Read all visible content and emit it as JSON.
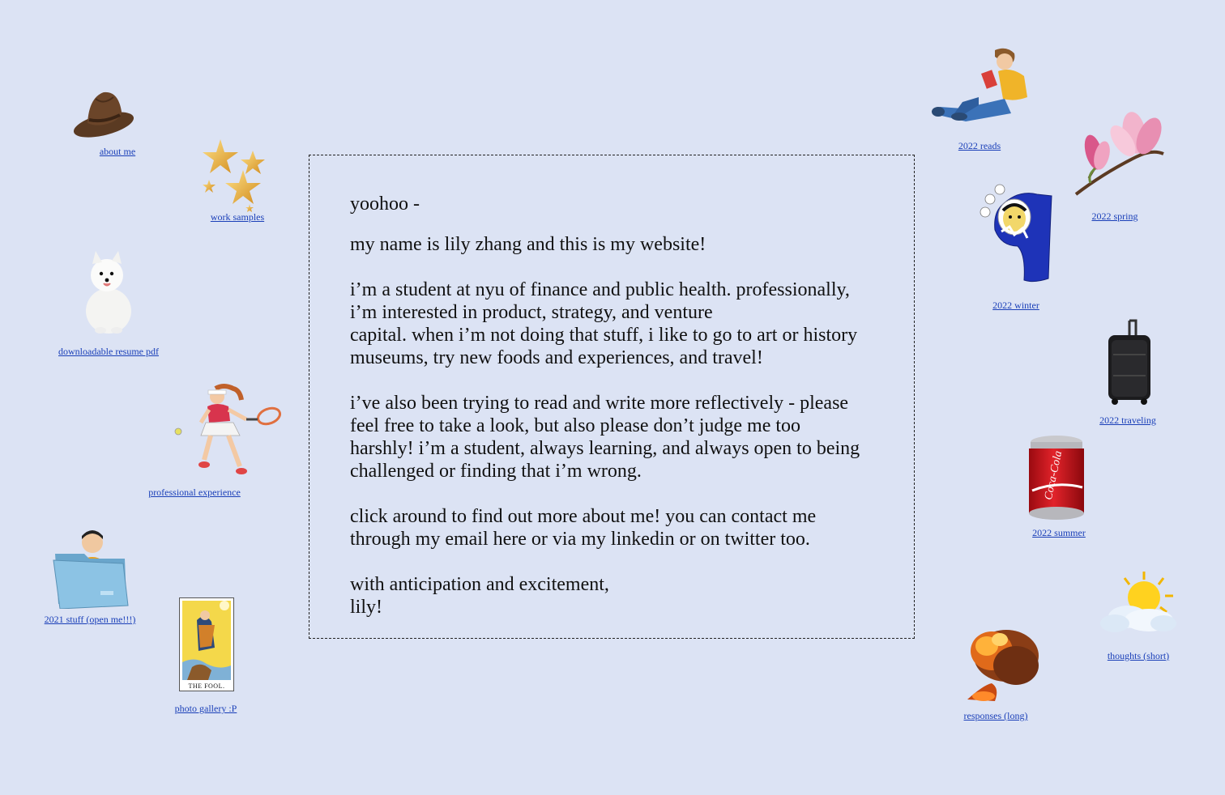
{
  "links": {
    "about_me": "about me",
    "work_samples": "work samples",
    "resume": "downloadable resume pdf",
    "professional_experience": "professional experience",
    "stuff_2021": "2021 stuff (open me!!!)",
    "photo_gallery": "photo gallery :P",
    "reads_2022": "2022 reads",
    "spring_2022": "2022 spring",
    "winter_2022": "2022 winter",
    "traveling_2022": "2022 traveling",
    "summer_2022": "2022 summer",
    "thoughts_short": "thoughts (short)",
    "responses_long": "responses (long)"
  },
  "icons": {
    "about_me": "cowboy-hat-icon",
    "work_samples": "gold-stars-icon",
    "resume": "white-dog-icon",
    "professional_experience": "tennis-player-icon",
    "stuff_2021": "folder-person-icon",
    "photo_gallery": "tarot-card-icon",
    "reads_2022": "reading-person-icon",
    "spring_2022": "magnolia-flower-icon",
    "winter_2022": "winter-parka-icon",
    "traveling_2022": "suitcase-icon",
    "summer_2022": "soda-can-icon",
    "thoughts_short": "sun-cloud-icon",
    "responses_long": "explosion-icon"
  },
  "tarot_label": "THE FOOL.",
  "soda_brand": "Coca-Cola",
  "letter": {
    "greeting": "yoohoo -",
    "intro": "my name is lily zhang and this is my website!",
    "p1_l1": "i’m a student at nyu of finance and public health. professionally,",
    "p1_l2": "i’m interested in product, strategy, and venture",
    "p1_l3": "capital. when i’m not doing that stuff, i like to go to art or history",
    "p1_l4": "museums, try new foods and experiences, and travel!",
    "p2_l1": "i’ve also been trying to read and write more reflectively - please",
    "p2_l2": "feel free to take a look, but also please don’t judge me too",
    "p2_l3": "harshly! i’m a student, always learning, and always open to being",
    "p2_l4": "challenged or finding that i’m wrong.",
    "p3_l1": "click around to find out more about me! you can contact me",
    "p3_l2": "through my email here or via my linkedin or on twitter too.",
    "closing": "with anticipation and excitement,",
    "signature": "lily!"
  },
  "colors": {
    "background": "#dce3f4",
    "link": "#1a3fb8"
  }
}
